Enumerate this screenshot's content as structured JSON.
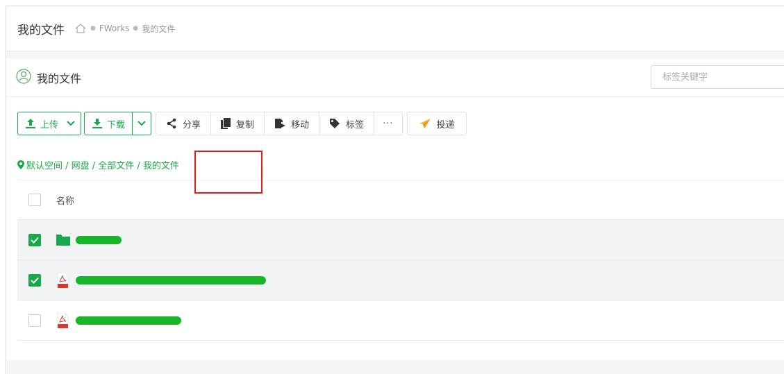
{
  "header": {
    "title": "我的文件",
    "breadcrumb": [
      "FWorks",
      "我的文件"
    ]
  },
  "card": {
    "title": "我的文件",
    "tag_search_placeholder": "标签关键字"
  },
  "toolbar": {
    "upload_label": "上传",
    "download_label": "下载",
    "share_label": "分享",
    "copy_label": "复制",
    "move_label": "移动",
    "tag_label": "标签",
    "more_label": "···",
    "deliver_label": "投递"
  },
  "path": "默认空间 / 网盘 / 全部文件 / 我的文件",
  "table": {
    "name_header": "名称",
    "rows": [
      {
        "type": "folder",
        "checked": true
      },
      {
        "type": "pdf",
        "checked": true
      },
      {
        "type": "pdf",
        "checked": false
      }
    ]
  },
  "colors": {
    "accent": "#19a74c",
    "highlight_border": "#e02020",
    "redaction": "#18b52a"
  }
}
